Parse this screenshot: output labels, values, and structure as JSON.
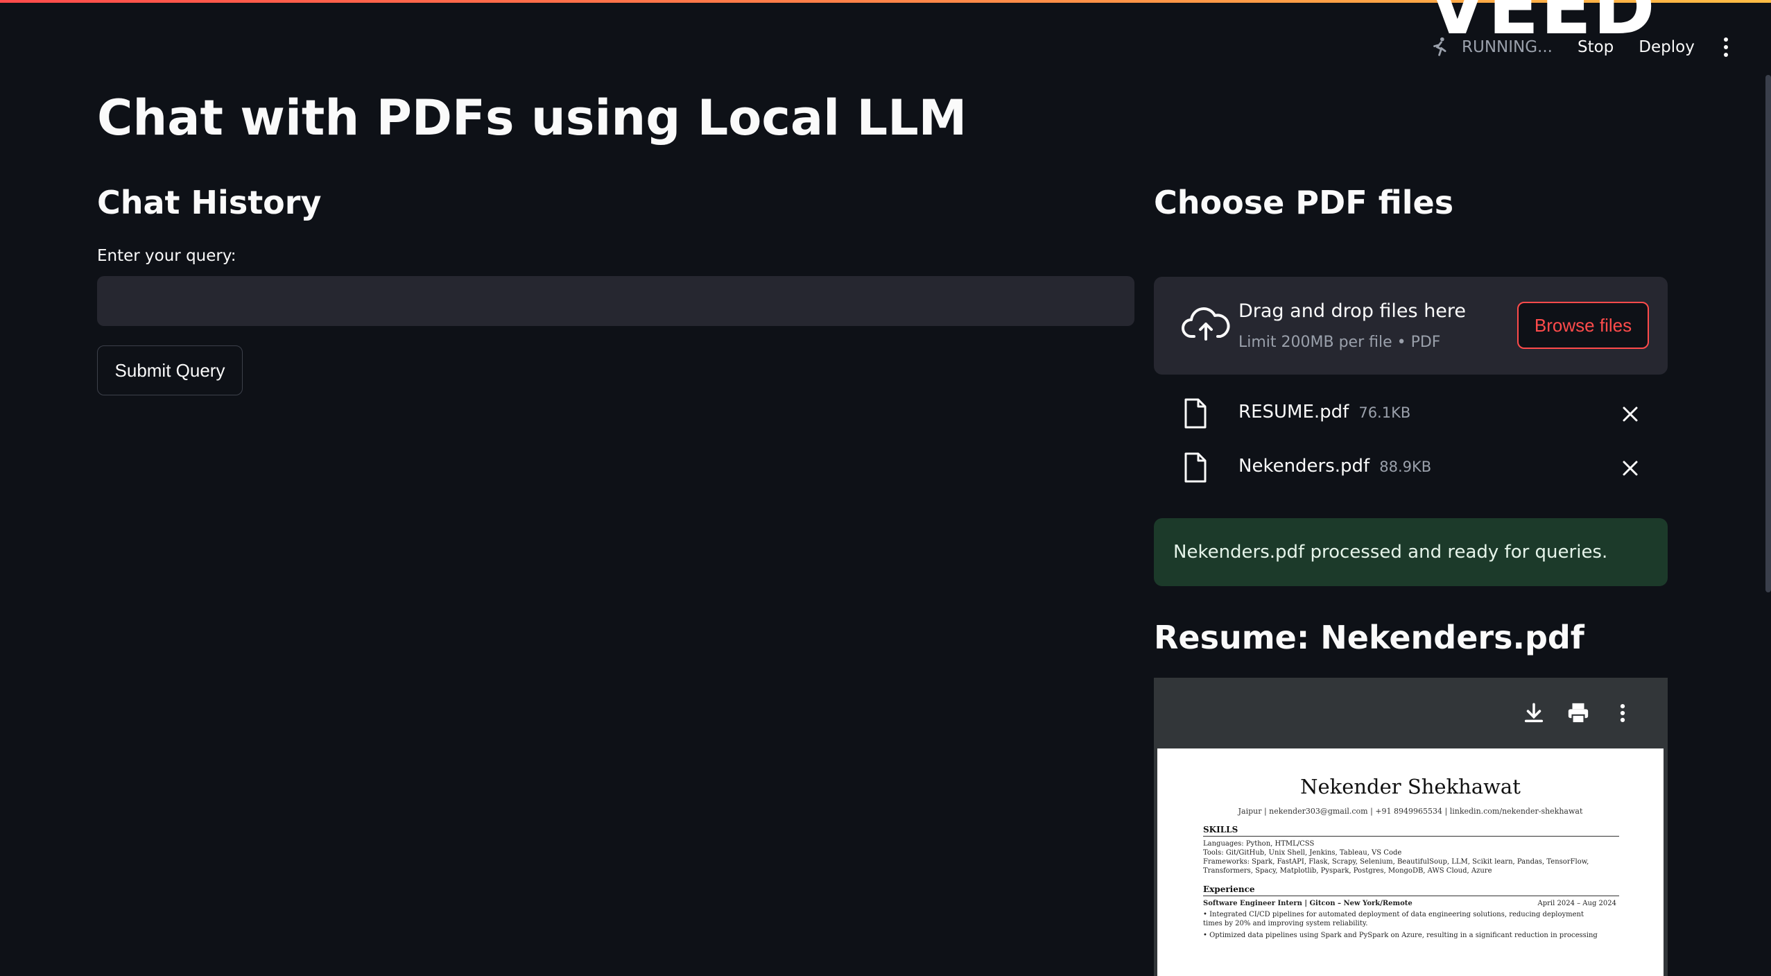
{
  "watermark": "VEED",
  "toolbar": {
    "status": "RUNNING...",
    "stop": "Stop",
    "deploy": "Deploy",
    "menu_icon": "kebab-vertical-icon"
  },
  "title": "Chat with PDFs using Local LLM",
  "chat": {
    "heading": "Chat History",
    "query_label": "Enter your query:",
    "query_value": "",
    "submit_label": "Submit Query"
  },
  "uploader": {
    "heading": "Choose PDF files",
    "drop_title": "Drag and drop files here",
    "drop_subtitle": "Limit 200MB per file • PDF",
    "browse_label": "Browse files",
    "files": [
      {
        "name": "RESUME.pdf",
        "size": "76.1KB"
      },
      {
        "name": "Nekenders.pdf",
        "size": "88.9KB"
      }
    ]
  },
  "success_message": "Nekenders.pdf processed and ready for queries.",
  "resume": {
    "heading": "Resume: Nekenders.pdf",
    "name": "Nekender Shekhawat",
    "contact": "Jaipur | nekender303@gmail.com | +91 8949965534 | linkedin.com/nekender-shekhawat",
    "skills_heading": "SKILLS",
    "skills": [
      "Languages: Python, HTML/CSS",
      "Tools: Git/GitHub, Unix Shell, Jenkins, Tableau, VS Code",
      "Frameworks: Spark, FastAPI, Flask, Scrapy, Selenium, BeautifulSoup, LLM, Scikit learn, Pandas, TensorFlow,",
      "Transformers, Spacy, Matplotlib, Pyspark, Postgres, MongoDB, AWS Cloud, Azure"
    ],
    "experience_heading": "Experience",
    "role": "Software Engineer Intern | Gitcon – New York/Remote",
    "role_dates": "April 2024 – Aug 2024",
    "bullets": [
      "• Integrated CI/CD pipelines for automated deployment of data engineering solutions, reducing deployment",
      "  times by 20% and improving system reliability.",
      "• Optimized data pipelines using Spark and PySpark on Azure, resulting in a significant reduction in processing"
    ]
  }
}
